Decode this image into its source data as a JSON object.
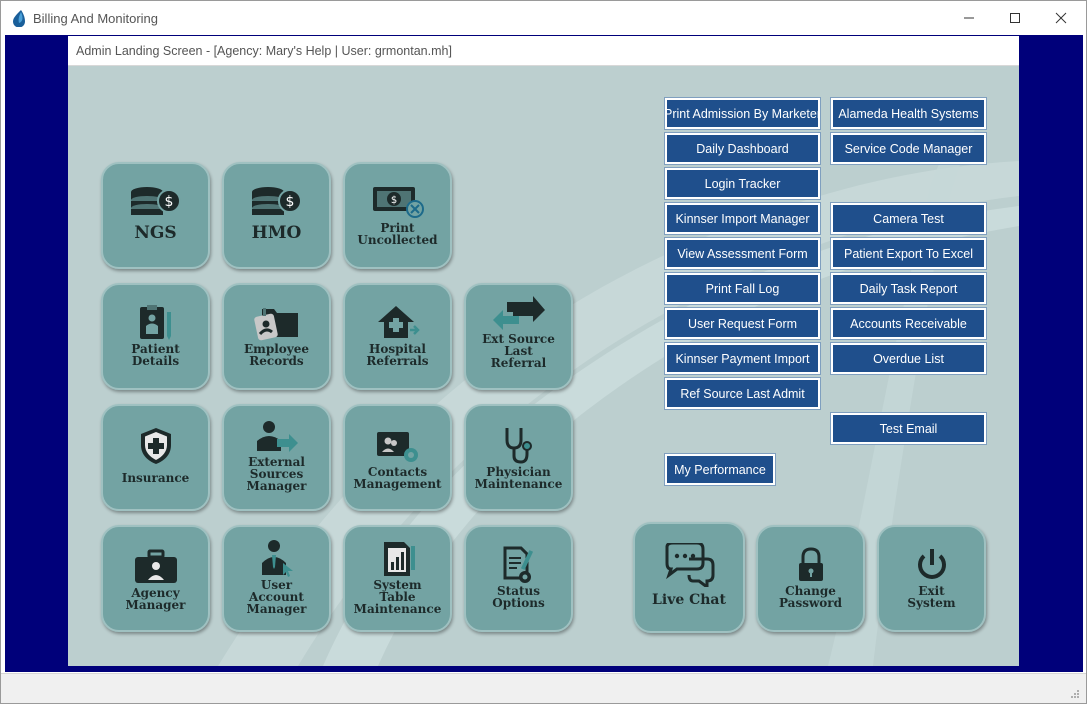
{
  "window": {
    "title": "Billing And Monitoring",
    "icon": "water-drop-icon"
  },
  "header": {
    "title": "Admin Landing Screen - [Agency: Mary's Help | User: grmontan.mh]"
  },
  "tiles": {
    "ngs": {
      "label": "NGS",
      "icon": "coin-stack-dollar-icon"
    },
    "hmo": {
      "label": "HMO",
      "icon": "coin-stack-dollar-icon"
    },
    "print_uncollected": {
      "line1": "Print",
      "line2": "Uncollected",
      "icon": "banknote-cancel-icon"
    },
    "patient_details": {
      "line1": "Patient",
      "line2": "Details",
      "icon": "patient-clipboard-icon"
    },
    "employee_records": {
      "line1": "Employee",
      "line2": "Records",
      "icon": "employee-folder-icon"
    },
    "hospital_referrals": {
      "line1": "Hospital",
      "line2": "Referrals",
      "icon": "hospital-house-icon"
    },
    "ext_source": {
      "line1": "Ext Source",
      "line2": "Last",
      "line3": "Referral",
      "icon": "exchange-arrows-icon"
    },
    "insurance": {
      "label": "Insurance",
      "icon": "shield-cross-icon"
    },
    "external_sources": {
      "line1": "External",
      "line2": "Sources",
      "line3": "Manager",
      "icon": "person-arrow-icon"
    },
    "contacts": {
      "line1": "Contacts",
      "line2": "Management",
      "icon": "contact-card-gear-icon"
    },
    "physician": {
      "line1": "Physician",
      "line2": "Maintenance",
      "icon": "stethoscope-icon"
    },
    "agency_manager": {
      "line1": "Agency",
      "line2": "Manager",
      "icon": "briefcase-person-icon"
    },
    "user_account": {
      "line1": "User",
      "line2": "Account",
      "line3": "Manager",
      "icon": "user-cursor-icon"
    },
    "system_table": {
      "line1": "System",
      "line2": "Table",
      "line3": "Maintenance",
      "icon": "report-chart-icon"
    },
    "status_options": {
      "line1": "Status",
      "line2": "Options",
      "icon": "document-gear-icon"
    },
    "live_chat": {
      "label": "Live Chat",
      "icon": "chat-bubbles-icon"
    },
    "change_password": {
      "line1": "Change",
      "line2": "Password",
      "icon": "padlock-icon"
    },
    "exit_system": {
      "line1": "Exit",
      "line2": "System",
      "icon": "power-icon"
    }
  },
  "buttons": {
    "print_admission": "Print Admission By Marketer",
    "alameda": "Alameda Health Systems",
    "daily_dashboard": "Daily Dashboard",
    "service_code": "Service Code Manager",
    "login_tracker": "Login Tracker",
    "kinnser_import": "Kinnser Import Manager",
    "camera_test": "Camera Test",
    "view_assessment": "View Assessment Form",
    "patient_export": "Patient Export To Excel",
    "print_fall": "Print Fall Log",
    "daily_task": "Daily Task Report",
    "user_request": "User Request Form",
    "accounts_receivable": "Accounts Receivable",
    "kinnser_payment": "Kinnser Payment Import",
    "overdue_list": "Overdue List",
    "ref_source": "Ref Source Last Admit",
    "test_email": "Test Email",
    "my_performance": "My Performance"
  },
  "colors": {
    "frame": "#00007a",
    "panel": "#bccfcf",
    "tile": "#73a3a3",
    "button": "#1f4f8c",
    "icon_dark": "#24403f",
    "icon_accent": "#3d8f8f"
  }
}
